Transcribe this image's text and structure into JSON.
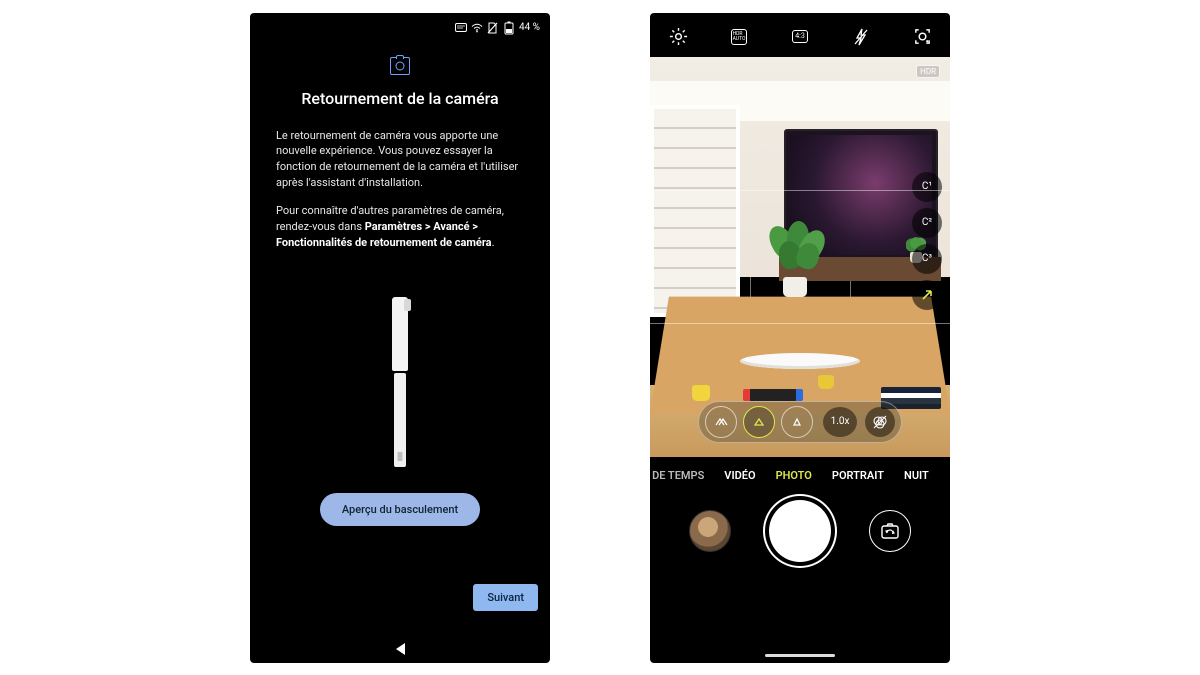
{
  "left": {
    "status": {
      "battery": "44 %"
    },
    "title": "Retournement de la caméra",
    "para1": "Le retournement de caméra vous apporte une nouvelle expérience. Vous pouvez essayer la fonction de retournement de la caméra et l'utiliser après l'assistant d'installation.",
    "para2_prefix": "Pour connaître d'autres paramètres de caméra, rendez-vous dans ",
    "para2_bold": "Paramètres > Avancé > Fonctionnalités de retournement de caméra",
    "para2_suffix": ".",
    "preview_button": "Aperçu du basculement",
    "next_button": "Suivant"
  },
  "right": {
    "top": {
      "ratio": "4:3",
      "hdr": "HDR"
    },
    "side": {
      "c1": "C¹",
      "c2": "C²",
      "c3": "C³"
    },
    "zoom": {
      "label": "1.0x"
    },
    "modes": {
      "truncated": "E DE TEMPS",
      "video": "VIDÉO",
      "photo": "PHOTO",
      "portrait": "PORTRAIT",
      "night": "NUIT"
    }
  }
}
